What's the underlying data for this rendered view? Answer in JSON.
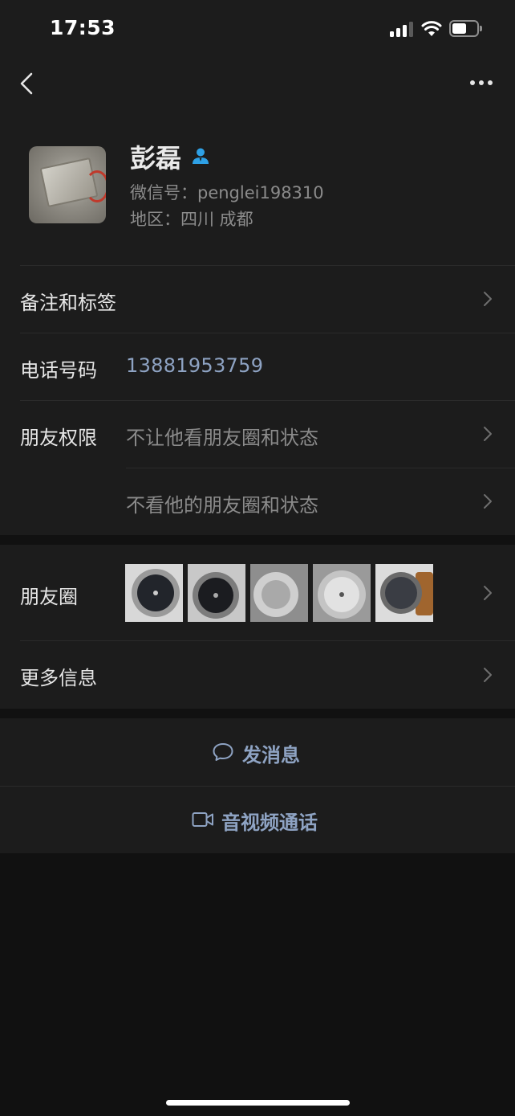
{
  "status_bar": {
    "time": "17:53",
    "battery_level": 0.58
  },
  "nav": {
    "back_icon": "chevron-left-icon",
    "more_icon": "ellipsis-icon"
  },
  "profile": {
    "name": "彭磊",
    "wechat_id": "微信号：penglei198310",
    "region": "地区：四川 成都",
    "contact_icon": "contact-person-icon",
    "badge_color": "#2ea1e6"
  },
  "rows": {
    "remark": {
      "label": "备注和标签"
    },
    "phone": {
      "label": "电话号码",
      "value": "13881953759"
    },
    "permissions": {
      "label": "朋友权限",
      "option_1": "不让他看朋友圈和状态",
      "option_2": "不看他的朋友圈和状态"
    },
    "moments": {
      "label": "朋友圈",
      "photo_count": 5
    },
    "more_info": {
      "label": "更多信息"
    }
  },
  "actions": {
    "message": {
      "label": "发消息",
      "icon": "chat-bubble-icon"
    },
    "call": {
      "label": "音视频通话",
      "icon": "video-camera-icon"
    }
  },
  "colors": {
    "background": "#111111",
    "panel": "#1c1c1c",
    "link": "#8ea3c3",
    "secondary_text": "#8b8b8b"
  }
}
